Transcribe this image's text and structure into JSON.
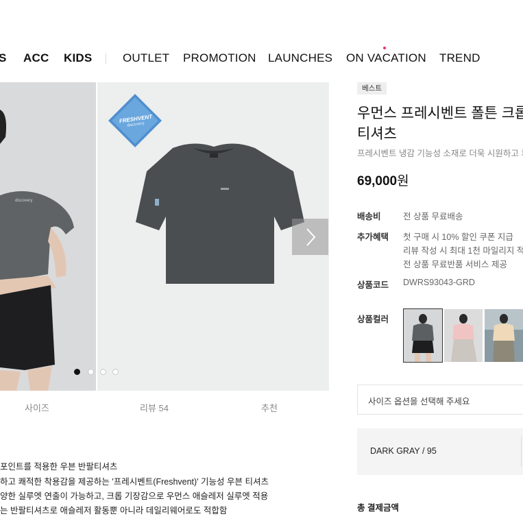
{
  "nav": {
    "items": [
      "S",
      "ACC",
      "KIDS",
      "OUTLET",
      "PROMOTION",
      "LAUNCHES",
      "ON VACATION",
      "TREND"
    ]
  },
  "gallery": {
    "badge_text": "FRESHVENT",
    "badge_sub": "discovery",
    "slide_count": 4,
    "active_slide": 1
  },
  "tabs": [
    "사이즈",
    "리뷰 54",
    "추천"
  ],
  "description": [
    "포인트를 적용한 우븐 반팔티셔츠",
    "하고 쾌적한 착용감을 제공하는 '프레시벤트(Freshvent)' 기능성 우븐 티셔츠",
    "양한 실루엣 연출이 가능하고, 크롭 기장감으로 우먼스 애슬레저 실루엣 적용",
    "는 반팔티셔츠로 애슬레저 활동뿐 아니라 데일리웨어로도 적합함"
  ],
  "product": {
    "badge": "베스트",
    "title_line1": "우먼스 프레시벤트 폴튼 크롭",
    "title_line2": "티셔츠",
    "subtitle": "프레시벤트 냉감 기능성 소재로 더욱 시원하고 쾌",
    "price": "69,000",
    "price_unit": "원",
    "shipping_label": "배송비",
    "shipping_value": "전 상품 무료배송",
    "benefit_label": "추가혜택",
    "benefits": [
      "첫 구매 시 10% 할인 쿠폰 지급",
      "리뷰 작성 시 최대 1천 마일리지 적",
      "전 상품 무료반품 서비스 제공"
    ],
    "code_label": "상품코드",
    "code_value": "DWRS93043-GRD",
    "color_label": "상품컬러",
    "colors": [
      "#5b5f62",
      "#f1c4c4",
      "#efd9b8"
    ]
  },
  "size_select": {
    "placeholder": "사이즈 옵션을 선택해 주세요"
  },
  "selected_option": "DARK GRAY / 95",
  "total_label": "총 결제금액"
}
